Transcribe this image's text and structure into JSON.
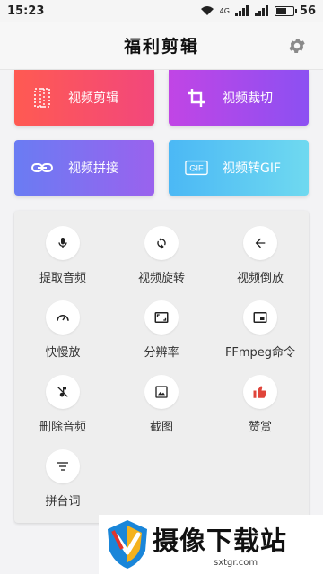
{
  "status_bar": {
    "time": "15:23",
    "network": "4G",
    "battery": "56"
  },
  "header": {
    "title": "福利剪辑",
    "settings_icon": "gear-icon"
  },
  "tiles": [
    {
      "label": "视频剪辑",
      "icon": "film-strip-icon",
      "colors": [
        "#ff5a52",
        "#f2477c"
      ]
    },
    {
      "label": "视频裁切",
      "icon": "crop-icon",
      "colors": [
        "#c145e5",
        "#8c50f2"
      ]
    },
    {
      "label": "视频拼接",
      "icon": "link-icon",
      "colors": [
        "#6a7cf3",
        "#9a62ee"
      ]
    },
    {
      "label": "视频转GIF",
      "icon": "gif-icon",
      "colors": [
        "#4bb8f5",
        "#6fd9f0"
      ]
    }
  ],
  "tools": [
    {
      "label": "提取音频",
      "icon": "mic-icon"
    },
    {
      "label": "视频旋转",
      "icon": "rotate-icon"
    },
    {
      "label": "视频倒放",
      "icon": "arrow-left-icon"
    },
    {
      "label": "快慢放",
      "icon": "speedometer-icon"
    },
    {
      "label": "分辨率",
      "icon": "aspect-ratio-icon"
    },
    {
      "label": "FFmpeg命令",
      "icon": "picture-in-picture-icon"
    },
    {
      "label": "删除音频",
      "icon": "music-off-icon"
    },
    {
      "label": "截图",
      "icon": "image-icon"
    },
    {
      "label": "赞赏",
      "icon": "thumbs-up-icon"
    },
    {
      "label": "拼台词",
      "icon": "subtitles-icon"
    }
  ],
  "watermark": {
    "title": "摄像下载站",
    "url": "sxtgr.com"
  }
}
